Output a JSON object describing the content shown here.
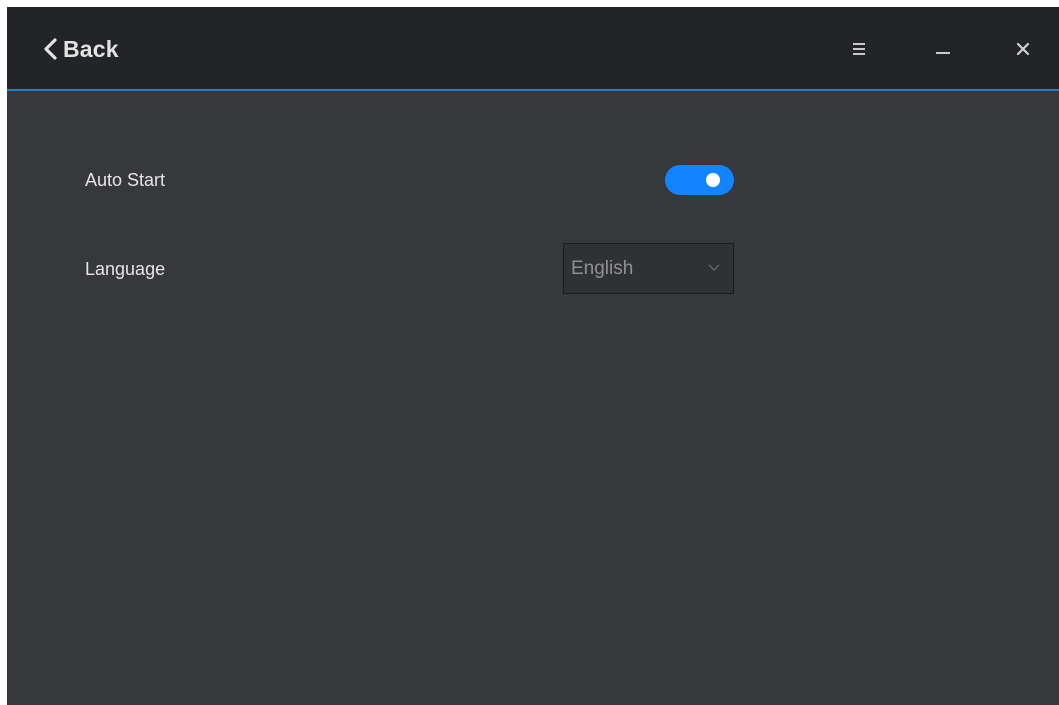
{
  "header": {
    "back_label": "Back",
    "back_icon": "chevron-left-icon",
    "menu_icon": "hamburger-menu-icon",
    "minimize_icon": "minimize-icon",
    "close_icon": "close-icon"
  },
  "settings": {
    "auto_start": {
      "label": "Auto Start",
      "enabled": true
    },
    "language": {
      "label": "Language",
      "selected": "English"
    }
  },
  "colors": {
    "background": "#37383c",
    "titlebar": "#232427",
    "accent": "#1384ff",
    "divider": "#1e7fd6"
  }
}
